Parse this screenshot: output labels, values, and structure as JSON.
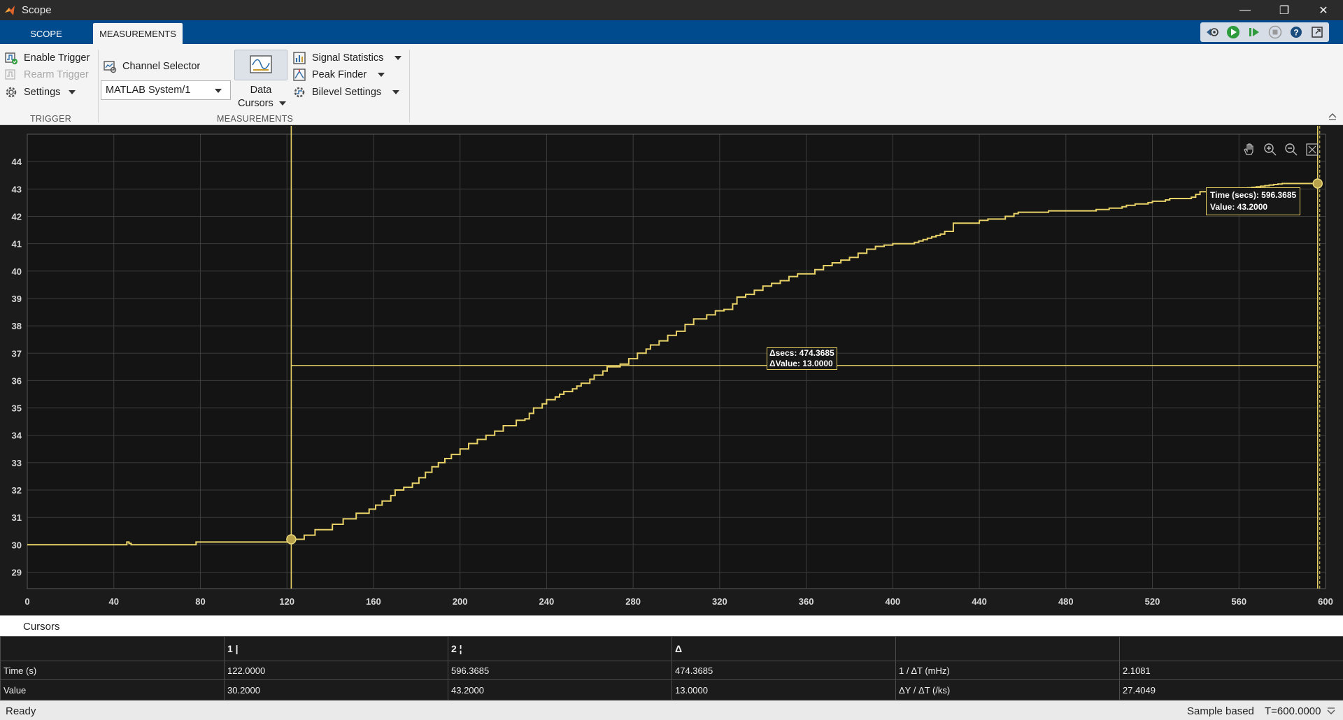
{
  "window": {
    "title": "Scope",
    "controls": {
      "minimize": "—",
      "restore": "❐",
      "close": "✕"
    }
  },
  "tabs": [
    "SCOPE",
    "MEASUREMENTS"
  ],
  "active_tab": "MEASUREMENTS",
  "ribbon": {
    "trigger": {
      "label": "TRIGGER",
      "enable_trigger": "Enable Trigger",
      "rearm_trigger": "Rearm Trigger",
      "settings": "Settings"
    },
    "measurements": {
      "label": "MEASUREMENTS",
      "channel_selector": "Channel Selector",
      "channel_value": "MATLAB System/1",
      "data_cursors_line1": "Data",
      "data_cursors_line2": "Cursors",
      "signal_statistics": "Signal Statistics",
      "peak_finder": "Peak Finder",
      "bilevel_settings": "Bilevel Settings"
    }
  },
  "chart_data": {
    "type": "line",
    "title": "",
    "xlabel": "",
    "ylabel": "",
    "xlim": [
      0,
      600
    ],
    "ylim": [
      28.4,
      45.0
    ],
    "xticks": [
      0,
      40,
      80,
      120,
      160,
      200,
      240,
      280,
      320,
      360,
      400,
      440,
      480,
      520,
      560,
      600
    ],
    "yticks": [
      29,
      30,
      31,
      32,
      33,
      34,
      35,
      36,
      37,
      38,
      39,
      40,
      41,
      42,
      43,
      44
    ],
    "grid": true,
    "line_color": "#e8d268",
    "background": "#141414",
    "step": true,
    "series": [
      {
        "x": [
          0,
          46,
          47,
          48,
          78,
          122,
          128,
          133,
          141,
          146,
          152,
          158,
          161,
          164,
          168,
          170,
          174,
          178,
          181,
          184,
          187,
          190,
          193,
          196,
          200,
          204,
          208,
          212,
          216,
          220,
          226,
          230,
          232,
          234,
          238,
          240,
          244,
          246,
          248,
          252,
          254,
          256,
          260,
          262,
          266,
          268,
          274,
          278,
          282,
          286,
          288,
          292,
          296,
          300,
          304,
          308,
          314,
          318,
          322,
          326,
          328,
          332,
          336,
          340,
          344,
          348,
          352,
          356,
          364,
          368,
          372,
          376,
          380,
          384,
          388,
          392,
          396,
          400,
          410,
          412,
          414,
          416,
          418,
          420,
          422,
          424,
          428,
          440,
          444,
          452,
          456,
          458,
          472,
          494,
          500,
          506,
          508,
          512,
          518,
          520,
          526,
          528,
          538,
          540,
          542,
          560,
          562,
          564,
          566,
          568,
          570,
          572,
          574,
          576,
          578,
          580,
          582,
          590,
          596.3685
        ],
        "y": [
          30.0,
          30.1,
          30.05,
          30.0,
          30.1,
          30.2,
          30.35,
          30.55,
          30.75,
          30.95,
          31.15,
          31.3,
          31.45,
          31.6,
          31.8,
          32.0,
          32.1,
          32.25,
          32.45,
          32.65,
          32.85,
          33.0,
          33.15,
          33.3,
          33.5,
          33.7,
          33.85,
          34.0,
          34.15,
          34.35,
          34.55,
          34.6,
          34.8,
          35.0,
          35.15,
          35.3,
          35.4,
          35.5,
          35.6,
          35.7,
          35.8,
          35.9,
          36.05,
          36.2,
          36.35,
          36.5,
          36.6,
          36.8,
          37.0,
          37.15,
          37.3,
          37.45,
          37.65,
          37.8,
          38.05,
          38.25,
          38.4,
          38.55,
          38.6,
          38.8,
          39.05,
          39.15,
          39.3,
          39.45,
          39.55,
          39.65,
          39.8,
          39.9,
          40.05,
          40.2,
          40.3,
          40.4,
          40.5,
          40.65,
          40.8,
          40.9,
          40.95,
          41.0,
          41.05,
          41.1,
          41.15,
          41.2,
          41.25,
          41.3,
          41.35,
          41.45,
          41.75,
          41.85,
          41.9,
          42.0,
          42.1,
          42.15,
          42.2,
          42.25,
          42.3,
          42.35,
          42.4,
          42.45,
          42.5,
          42.55,
          42.6,
          42.65,
          42.7,
          42.8,
          42.9,
          43.0,
          43.02,
          43.04,
          43.06,
          43.08,
          43.1,
          43.12,
          43.14,
          43.16,
          43.18,
          43.2,
          43.2,
          43.2,
          43.2
        ]
      }
    ],
    "cursors": [
      {
        "label": "1",
        "time": 122.0,
        "value": 30.2
      },
      {
        "label": "2",
        "time": 596.3685,
        "value": 43.2
      }
    ],
    "horizontal_cursor_value": 36.55,
    "annotations": {
      "cursor2_time": "Time (secs): 596.3685",
      "cursor2_value": "Value: 43.2000",
      "delta_secs": "Δsecs: 474.3685",
      "delta_value": "ΔValue: 13.0000"
    }
  },
  "cursors_panel": {
    "title": "Cursors",
    "headers": [
      "",
      "1 |",
      "2 ¦",
      "Δ",
      "",
      ""
    ],
    "rows": [
      [
        "Time (s)",
        "122.0000",
        "596.3685",
        "474.3685",
        "1 / ΔT (mHz)",
        "2.1081"
      ],
      [
        "Value",
        "30.2000",
        "43.2000",
        "13.0000",
        "ΔY / ΔT (/ks)",
        "27.4049"
      ]
    ]
  },
  "status": {
    "left": "Ready",
    "mode": "Sample based",
    "time": "T=600.0000"
  }
}
